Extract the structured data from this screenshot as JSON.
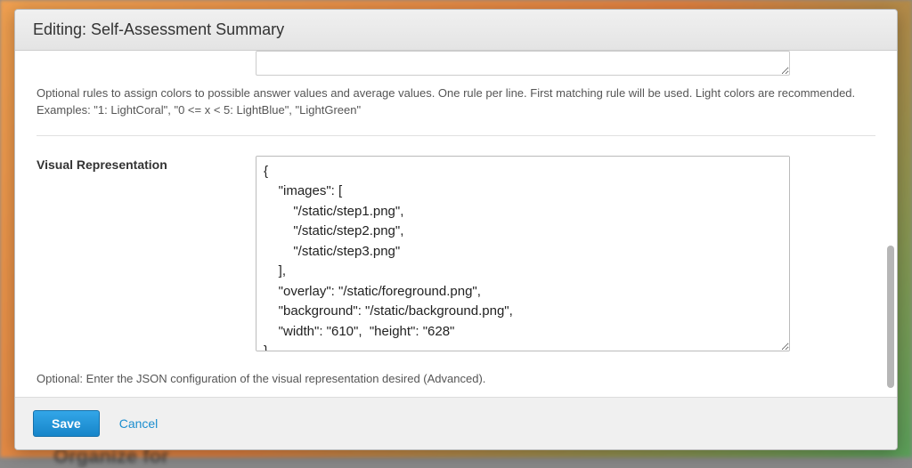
{
  "header": {
    "title": "Editing: Self-Assessment Summary"
  },
  "colorRules": {
    "helpText": "Optional rules to assign colors to possible answer values and average values. One rule per line. First matching rule will be used. Light colors are recommended. Examples: \"1: LightCoral\", \"0 <= x < 5: LightBlue\", \"LightGreen\""
  },
  "visualRep": {
    "label": "Visual Representation",
    "value": "{\n    \"images\": [\n        \"/static/step1.png\",\n        \"/static/step2.png\",\n        \"/static/step3.png\"\n    ],\n    \"overlay\": \"/static/foreground.png\",\n    \"background\": \"/static/background.png\",\n    \"width\": \"610\",  \"height\": \"628\"\n}",
    "helpText": "Optional: Enter the JSON configuration of the visual representation desired (Advanced)."
  },
  "footer": {
    "saveLabel": "Save",
    "cancelLabel": "Cancel"
  },
  "backdrop": {
    "t2": "Organize for"
  }
}
